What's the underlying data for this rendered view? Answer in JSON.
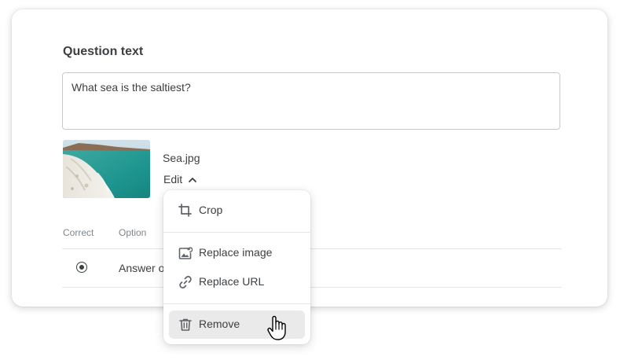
{
  "question": {
    "section_title": "Question text",
    "text": "What sea is the saltiest?"
  },
  "attachment": {
    "file_name": "Sea.jpg",
    "edit_label": "Edit"
  },
  "answers": {
    "col_correct": "Correct",
    "col_option": "Option",
    "rows": [
      {
        "option_text": "Answer o",
        "selected": true
      }
    ]
  },
  "menu": {
    "items": [
      {
        "label": "Crop",
        "icon": "crop-icon"
      },
      {
        "label": "Replace image",
        "icon": "replace-image-icon"
      },
      {
        "label": "Replace URL",
        "icon": "link-icon"
      },
      {
        "label": "Remove",
        "icon": "trash-icon"
      }
    ]
  },
  "colors": {
    "text": "#3c4043",
    "muted": "#80868b",
    "hover_bg": "#eaeaea"
  }
}
